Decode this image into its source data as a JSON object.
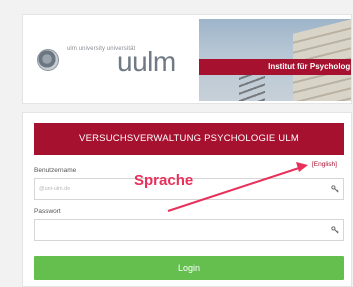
{
  "header": {
    "logo_small_text": "ulm university universität",
    "logo_big_text": "uulm",
    "banner_text": "Institut für Psychologie"
  },
  "login": {
    "title": "VERSUCHSVERWALTUNG PSYCHOLOGIE ULM",
    "language_link": "[English]",
    "username_label": "Benutzername",
    "username_placeholder": "@uni-ulm.de",
    "password_label": "Passwort",
    "password_placeholder": "",
    "login_button": "Login"
  },
  "annotation": {
    "text": "Sprache",
    "color": "#e8305a"
  },
  "colors": {
    "brand_red": "#a6112f",
    "login_green": "#64bf4f"
  }
}
